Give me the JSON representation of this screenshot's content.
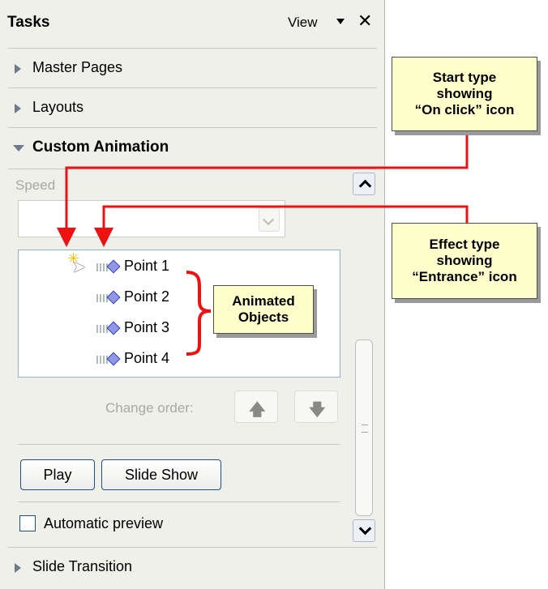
{
  "pane": {
    "title": "Tasks",
    "view_menu": "View",
    "close_icon": "close-icon"
  },
  "sections": {
    "master_pages": "Master Pages",
    "layouts": "Layouts",
    "custom_animation": "Custom Animation",
    "slide_transition": "Slide Transition"
  },
  "custom_animation": {
    "speed_label": "Speed",
    "speed_value": "",
    "effects": [
      {
        "label": "Point 1",
        "start_icon": "on-click-icon",
        "effect_icon": "entrance-icon"
      },
      {
        "label": "Point 2",
        "effect_icon": "entrance-icon"
      },
      {
        "label": "Point 3",
        "effect_icon": "entrance-icon"
      },
      {
        "label": "Point 4",
        "effect_icon": "entrance-icon"
      }
    ],
    "change_order_label": "Change order:",
    "play_label": "Play",
    "slide_show_label": "Slide Show",
    "automatic_preview_label": "Automatic preview",
    "automatic_preview_checked": false
  },
  "callouts": {
    "start_type": [
      "Start type",
      "showing",
      "“On click” icon"
    ],
    "effect_type": [
      "Effect type",
      "showing",
      "“Entrance” icon"
    ],
    "animated_objects": [
      "Animated",
      "Objects"
    ]
  },
  "colors": {
    "pane_bg": "#f0f0ea",
    "callout_bg": "#ffffcc",
    "annotation_red": "#ee1111",
    "button_border": "#1c4e88"
  }
}
